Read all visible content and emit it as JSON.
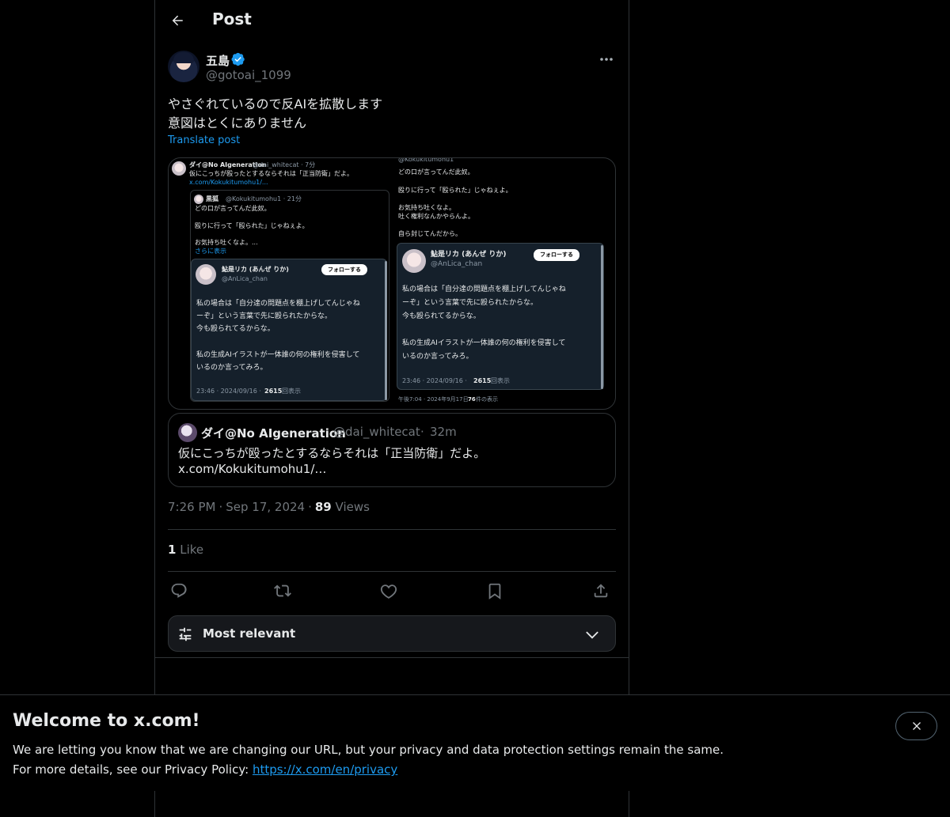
{
  "header": {
    "title": "Post"
  },
  "author": {
    "name": "五島",
    "handle": "@gotoai_1099"
  },
  "post": {
    "lines": [
      "やさぐれているので反AIを拡散します",
      "意図はとくにありません"
    ],
    "translate_label": "Translate post"
  },
  "media": {
    "left": {
      "top_name": "ダイ@No AIgeneration",
      "top_handle": "@dai_whitecat · 7分",
      "top_text": "仮にこっちが殴ったとするならそれは「正当防衛」だよ。",
      "top_link": "x.com/Kokukitumohu1/...",
      "q_name": "黒狐",
      "q_handle": "@Kokukitumohu1 · 21分",
      "q_line1": "どの口が言ってんだ此奴。",
      "q_line2": "殴りに行って「殴られた」じゃねぇよ。",
      "q_line3": "お気持ち吐くなよ。...",
      "q_more": "さらに表示",
      "card_name": "鮎是リカ (あんぜ りか)",
      "card_handle": "@AnLica_chan",
      "follow": "フォローする",
      "card_l1": "私の場合は「自分達の問題点を棚上げしてんじゃね",
      "card_l2": "ーぞ」という言葉で先に殴られたからな。",
      "card_l3": "今も殴られてるからな。",
      "card_l4": "私の生成AIイラストが一体誰の何の権利を侵害して",
      "card_l5": "いるのか言ってみろ。",
      "card_time": "23:46 · 2024/09/16 ·",
      "card_views_num": "2615",
      "card_views_label": "回表示"
    },
    "right": {
      "top_handle": "@Kokukitumohu1",
      "l1": "どの口が言ってんだ此奴。",
      "l2": "殴りに行って「殴られた」じゃねぇよ。",
      "l3": "お気持ち吐くなよ。",
      "l4": "吐く権利なんかやらんよ。",
      "l5": "自ら封じてんだから。",
      "card_name": "鮎是リカ (あんぜ りか)",
      "card_handle": "@AnLica_chan",
      "follow": "フォローする",
      "card_l1": "私の場合は「自分達の問題点を棚上げしてんじゃね",
      "card_l2": "ーぞ」という言葉で先に殴られたからな。",
      "card_l3": "今も殴られてるからな。",
      "card_l4": "私の生成AIイラストが一体誰の何の権利を侵害して",
      "card_l5": "いるのか言ってみろ。",
      "card_time": "23:46 · 2024/09/16 ·",
      "card_views_num": "2615",
      "card_views_label": "回表示",
      "footer_time": "午後7:04 · 2024年9月17日 ·",
      "footer_views_num": "76",
      "footer_views_label": "件の表示"
    }
  },
  "quote": {
    "name": "ダイ@No AIgeneration",
    "handle": "@dai_whitecat",
    "dot": "·",
    "time": "32m",
    "line1": "仮にこっちが殴ったとするならそれは「正当防衛」だよ。",
    "line2": "x.com/Kokukitumohu1/…"
  },
  "meta": {
    "time": "7:26 PM",
    "date": "Sep 17, 2024",
    "views_count": "89",
    "views_label": "Views",
    "sep": "·"
  },
  "likes": {
    "count": "1",
    "label": "Like"
  },
  "sort": {
    "label": "Most relevant"
  },
  "banner": {
    "title": "Welcome to x.com!",
    "line1": "We are letting you know that we are changing our URL, but your privacy and data protection settings remain the same.",
    "line2_prefix": "For more details, see our Privacy Policy: ",
    "link": "https://x.com/en/privacy"
  },
  "icons": {
    "back": "arrow-left-icon",
    "verified": "verified-badge-icon",
    "more": "more-horizontal-icon",
    "reply": "reply-icon",
    "repost": "repost-icon",
    "like": "heart-icon",
    "bookmark": "bookmark-icon",
    "share": "share-icon",
    "sort": "sliders-icon",
    "chevron": "chevron-down-icon",
    "close": "close-icon"
  },
  "colors": {
    "accent": "#1d9bf0",
    "background": "#000000",
    "border": "#2f3336",
    "muted": "#71767b"
  }
}
